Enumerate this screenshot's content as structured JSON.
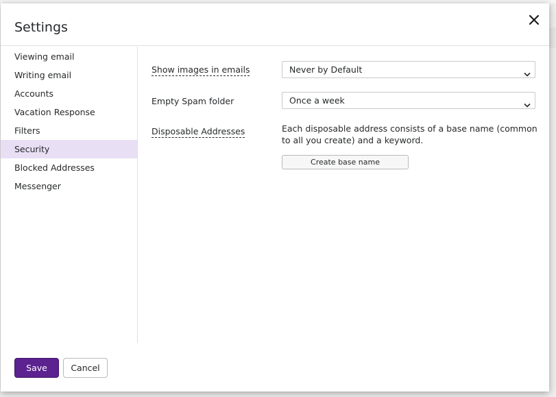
{
  "dialog": {
    "title": "Settings",
    "close_icon": "close-icon"
  },
  "sidebar": {
    "items": [
      {
        "label": "Viewing email",
        "active": false
      },
      {
        "label": "Writing email",
        "active": false
      },
      {
        "label": "Accounts",
        "active": false
      },
      {
        "label": "Vacation Response",
        "active": false
      },
      {
        "label": "Filters",
        "active": false
      },
      {
        "label": "Security",
        "active": true
      },
      {
        "label": "Blocked Addresses",
        "active": false
      },
      {
        "label": "Messenger",
        "active": false
      }
    ]
  },
  "security": {
    "show_images": {
      "label": "Show images in emails",
      "selected": "Never by Default"
    },
    "empty_spam": {
      "label": "Empty Spam folder",
      "selected": "Once a week"
    },
    "disposable": {
      "label": "Disposable Addresses",
      "description": "Each disposable address consists of a base name (common to all you create) and a keyword.",
      "button_label": "Create base name"
    }
  },
  "footer": {
    "save_label": "Save",
    "cancel_label": "Cancel"
  },
  "colors": {
    "accent": "#5b2290",
    "active_bg": "#e8dff5"
  }
}
